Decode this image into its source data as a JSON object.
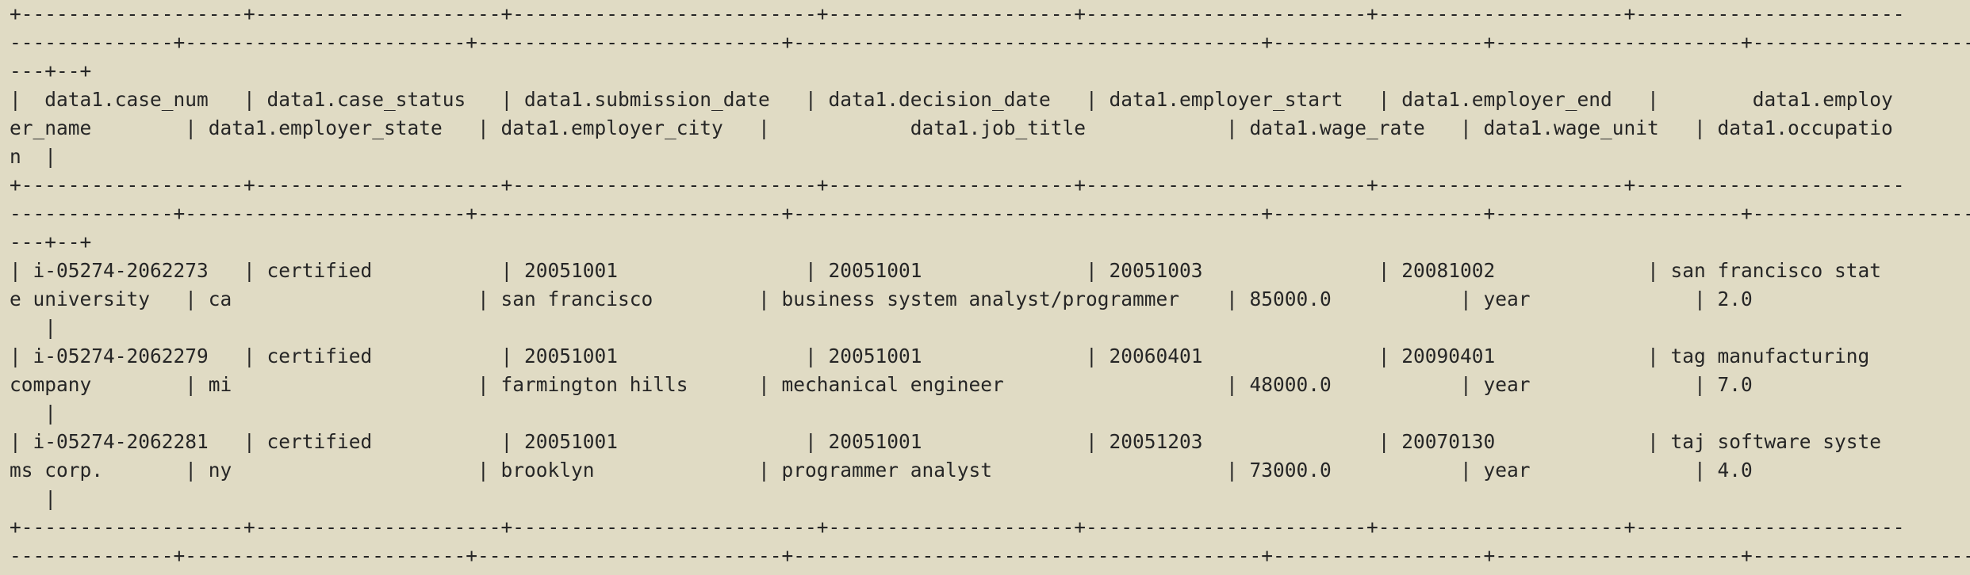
{
  "terminal": {
    "background": "#e0dbc4",
    "foreground": "#262626",
    "lines": [
      "+-------------------+---------------------+--------------------------+---------------------+------------------------+---------------------+-----------------------",
      "--------------+------------------------+--------------------------+----------------------------------------+------------------+---------------------+--------------------",
      "---+--+",
      "|  data1.case_num   | data1.case_status   | data1.submission_date   | data1.decision_date   | data1.employer_start   | data1.employer_end   |        data1.employ",
      "er_name        | data1.employer_state   | data1.employer_city   |            data1.job_title            | data1.wage_rate   | data1.wage_unit   | data1.occupatio",
      "n  |",
      "+-------------------+---------------------+--------------------------+---------------------+------------------------+---------------------+-----------------------",
      "--------------+------------------------+--------------------------+----------------------------------------+------------------+---------------------+--------------------",
      "---+--+",
      "| i-05274-2062273   | certified           | 20051001                | 20051001              | 20051003               | 20081002             | san francisco stat",
      "e university   | ca                     | san francisco         | business system analyst/programmer    | 85000.0           | year              | 2.0",
      "   |",
      "| i-05274-2062279   | certified           | 20051001                | 20051001              | 20060401               | 20090401             | tag manufacturing",
      "company        | mi                     | farmington hills      | mechanical engineer                   | 48000.0           | year              | 7.0",
      "   |",
      "| i-05274-2062281   | certified           | 20051001                | 20051001              | 20051203               | 20070130             | taj software syste",
      "ms corp.       | ny                     | brooklyn              | programmer analyst                    | 73000.0           | year              | 4.0",
      "   |",
      "+-------------------+---------------------+--------------------------+---------------------+------------------------+---------------------+-----------------------",
      "--------------+------------------------+--------------------------+----------------------------------------+------------------+---------------------+--------------------"
    ]
  }
}
